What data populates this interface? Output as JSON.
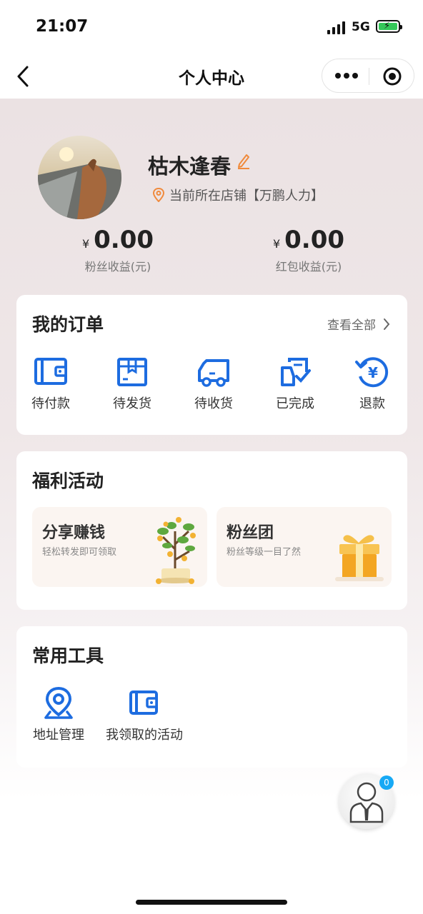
{
  "status_bar": {
    "time": "21:07",
    "network": "5G",
    "icons": [
      "signal-icon",
      "battery-charging-icon"
    ]
  },
  "nav": {
    "title": "个人中心",
    "icons": [
      "back-icon",
      "more-icon",
      "target-icon"
    ]
  },
  "profile": {
    "name": "枯木逢春",
    "store_text": "当前所在店铺【万鹏人力】",
    "fans_earnings": {
      "currency": "¥",
      "amount": "0.00",
      "label": "粉丝收益(元)"
    },
    "red_packet_earnings": {
      "currency": "¥",
      "amount": "0.00",
      "label": "红包收益(元)"
    }
  },
  "orders": {
    "title": "我的订单",
    "view_all": "查看全部",
    "items": [
      {
        "label": "待付款",
        "icon": "wallet-icon"
      },
      {
        "label": "待发货",
        "icon": "package-icon"
      },
      {
        "label": "待收货",
        "icon": "truck-icon"
      },
      {
        "label": "已完成",
        "icon": "completed-icon"
      },
      {
        "label": "退款",
        "icon": "refund-icon"
      }
    ]
  },
  "welfare": {
    "title": "福利活动",
    "items": [
      {
        "title": "分享赚钱",
        "subtitle": "轻松转发即可领取",
        "icon": "money-tree-icon"
      },
      {
        "title": "粉丝团",
        "subtitle": "粉丝等级一目了然",
        "icon": "gift-box-icon"
      }
    ]
  },
  "tools": {
    "title": "常用工具",
    "items": [
      {
        "label": "地址管理",
        "icon": "location-icon"
      },
      {
        "label": "我领取的活动",
        "icon": "wallet-icon"
      }
    ]
  },
  "service": {
    "badge": "0",
    "icon": "customer-service-icon"
  },
  "colors": {
    "accent": "#1d6ce0",
    "orange": "#f08a3c",
    "badge": "#17a9f5"
  }
}
